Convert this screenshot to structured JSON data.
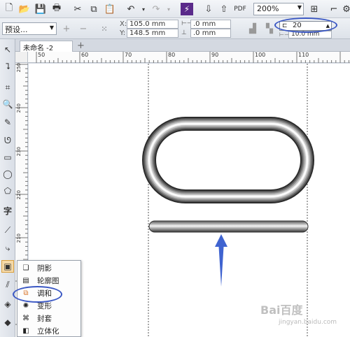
{
  "toolbar": {
    "zoom_value": "200%"
  },
  "property_bar": {
    "preset_value": "预设...",
    "x_label": "X:",
    "x_value": "105.0 mm",
    "y_label": "Y:",
    "y_value": "148.5 mm",
    "offset_x_value": ".0 mm",
    "offset_y_value": ".0 mm",
    "blend_steps_value": "20",
    "blend_spacing_value": "10.0 mm"
  },
  "document": {
    "tab_label": "未命名 -2"
  },
  "ruler": {
    "h_ticks": [
      "50",
      "60",
      "70",
      "80",
      "90",
      "100",
      "110"
    ],
    "v_ticks": [
      "250",
      "240",
      "230",
      "220",
      "210"
    ]
  },
  "flyout": {
    "items": [
      {
        "label": "阴影",
        "icon": "drop-shadow-icon"
      },
      {
        "label": "轮廓图",
        "icon": "contour-icon"
      },
      {
        "label": "调和",
        "icon": "blend-icon"
      },
      {
        "label": "变形",
        "icon": "distort-icon"
      },
      {
        "label": "封套",
        "icon": "envelope-icon"
      },
      {
        "label": "立体化",
        "icon": "extrude-icon"
      }
    ]
  },
  "watermark": {
    "text": "Bai百度",
    "sub": "jingyan.baidu.com"
  },
  "colors": {
    "annotation": "#3a57c4",
    "arrow": "#3f63d0"
  }
}
